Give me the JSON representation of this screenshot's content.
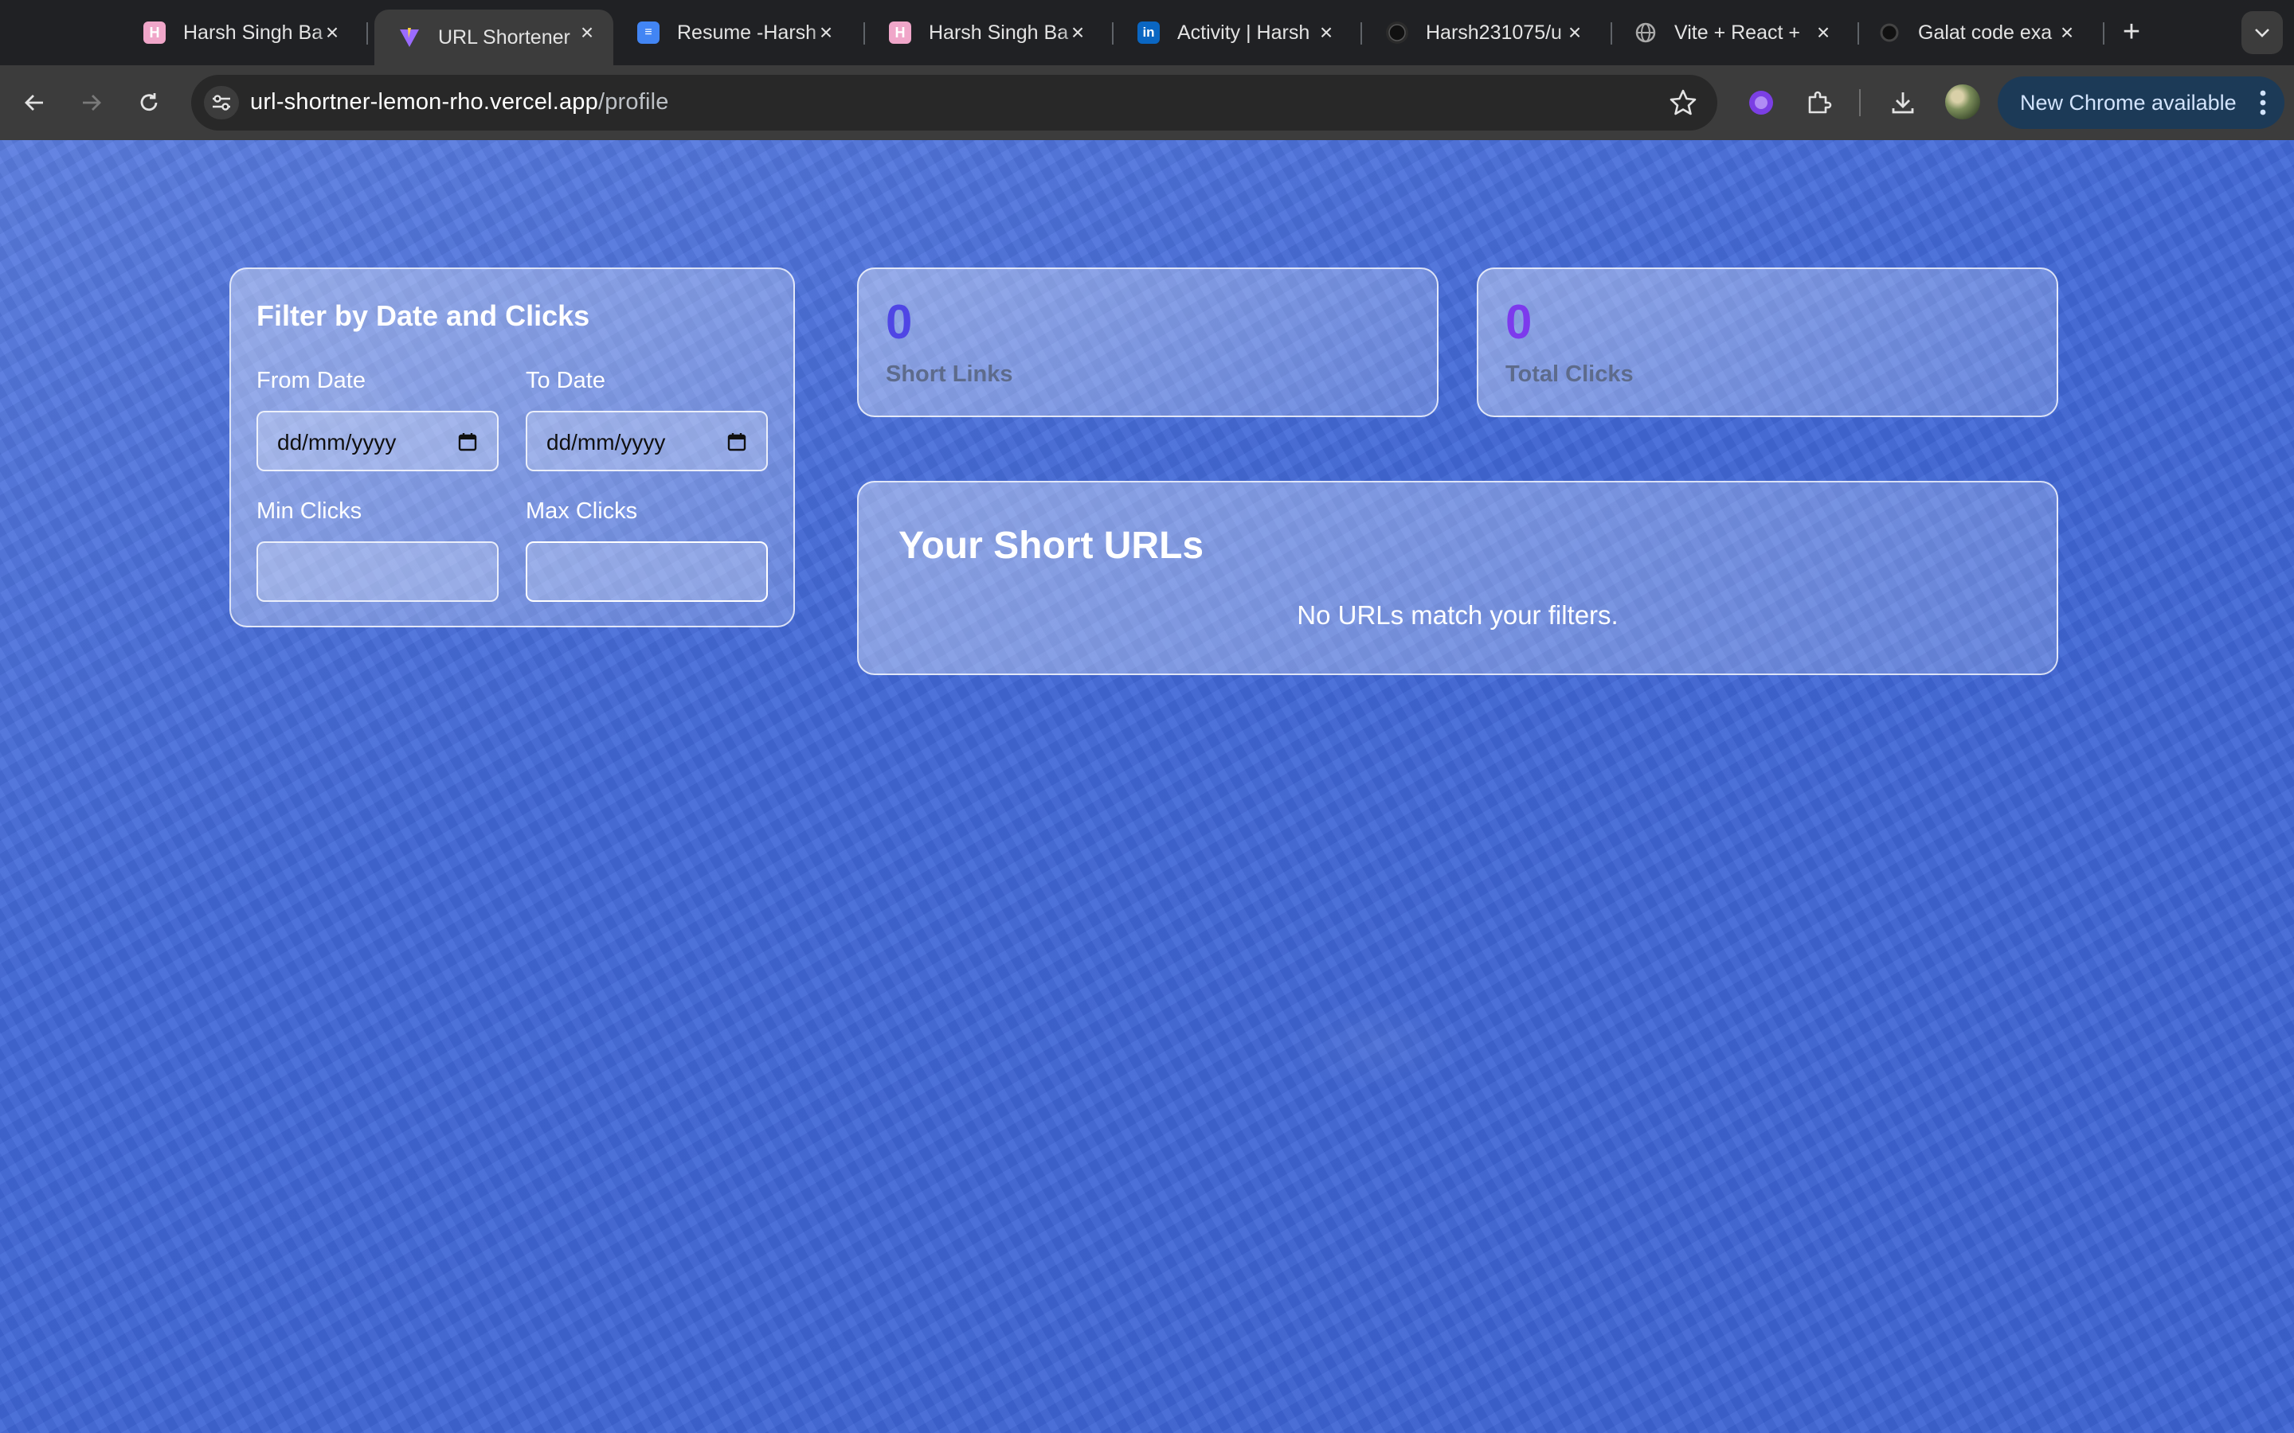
{
  "browser": {
    "tabs": [
      {
        "title": "Harsh Singh Ba",
        "favicon": "hashnode-icon",
        "active": false
      },
      {
        "title": "URL Shortener",
        "favicon": "vite-icon",
        "active": true
      },
      {
        "title": "Resume -Harsh",
        "favicon": "google-docs-icon",
        "active": false
      },
      {
        "title": "Harsh Singh Ba",
        "favicon": "hashnode-icon",
        "active": false
      },
      {
        "title": "Activity | Harsh",
        "favicon": "linkedin-icon",
        "active": false
      },
      {
        "title": "Harsh231075/u",
        "favicon": "github-icon",
        "active": false
      },
      {
        "title": "Vite + React +",
        "favicon": "globe-icon",
        "active": false
      },
      {
        "title": "Galat code exa",
        "favicon": "openai-icon",
        "active": false
      }
    ],
    "address": {
      "host": "url-shortner-lemon-rho.vercel.app",
      "path": "/profile"
    },
    "update_chip": "New Chrome available"
  },
  "filter": {
    "heading": "Filter by Date and Clicks",
    "from_label": "From Date",
    "from_value": "dd/mm/yyyy",
    "to_label": "To Date",
    "to_value": "dd/mm/yyyy",
    "min_label": "Min Clicks",
    "min_value": "",
    "max_label": "Max Clicks",
    "max_value": ""
  },
  "stats": {
    "short_links": {
      "value": "0",
      "label": "Short Links",
      "color": "#4f46e5"
    },
    "total_clicks": {
      "value": "0",
      "label": "Total Clicks",
      "color": "#7c3aed"
    }
  },
  "urls": {
    "heading": "Your Short URLs",
    "empty_message": "No URLs match your filters."
  },
  "colors": {
    "page_background": "#4269d8",
    "chrome_dark": "#202124",
    "toolbar": "#3c3c3c"
  }
}
